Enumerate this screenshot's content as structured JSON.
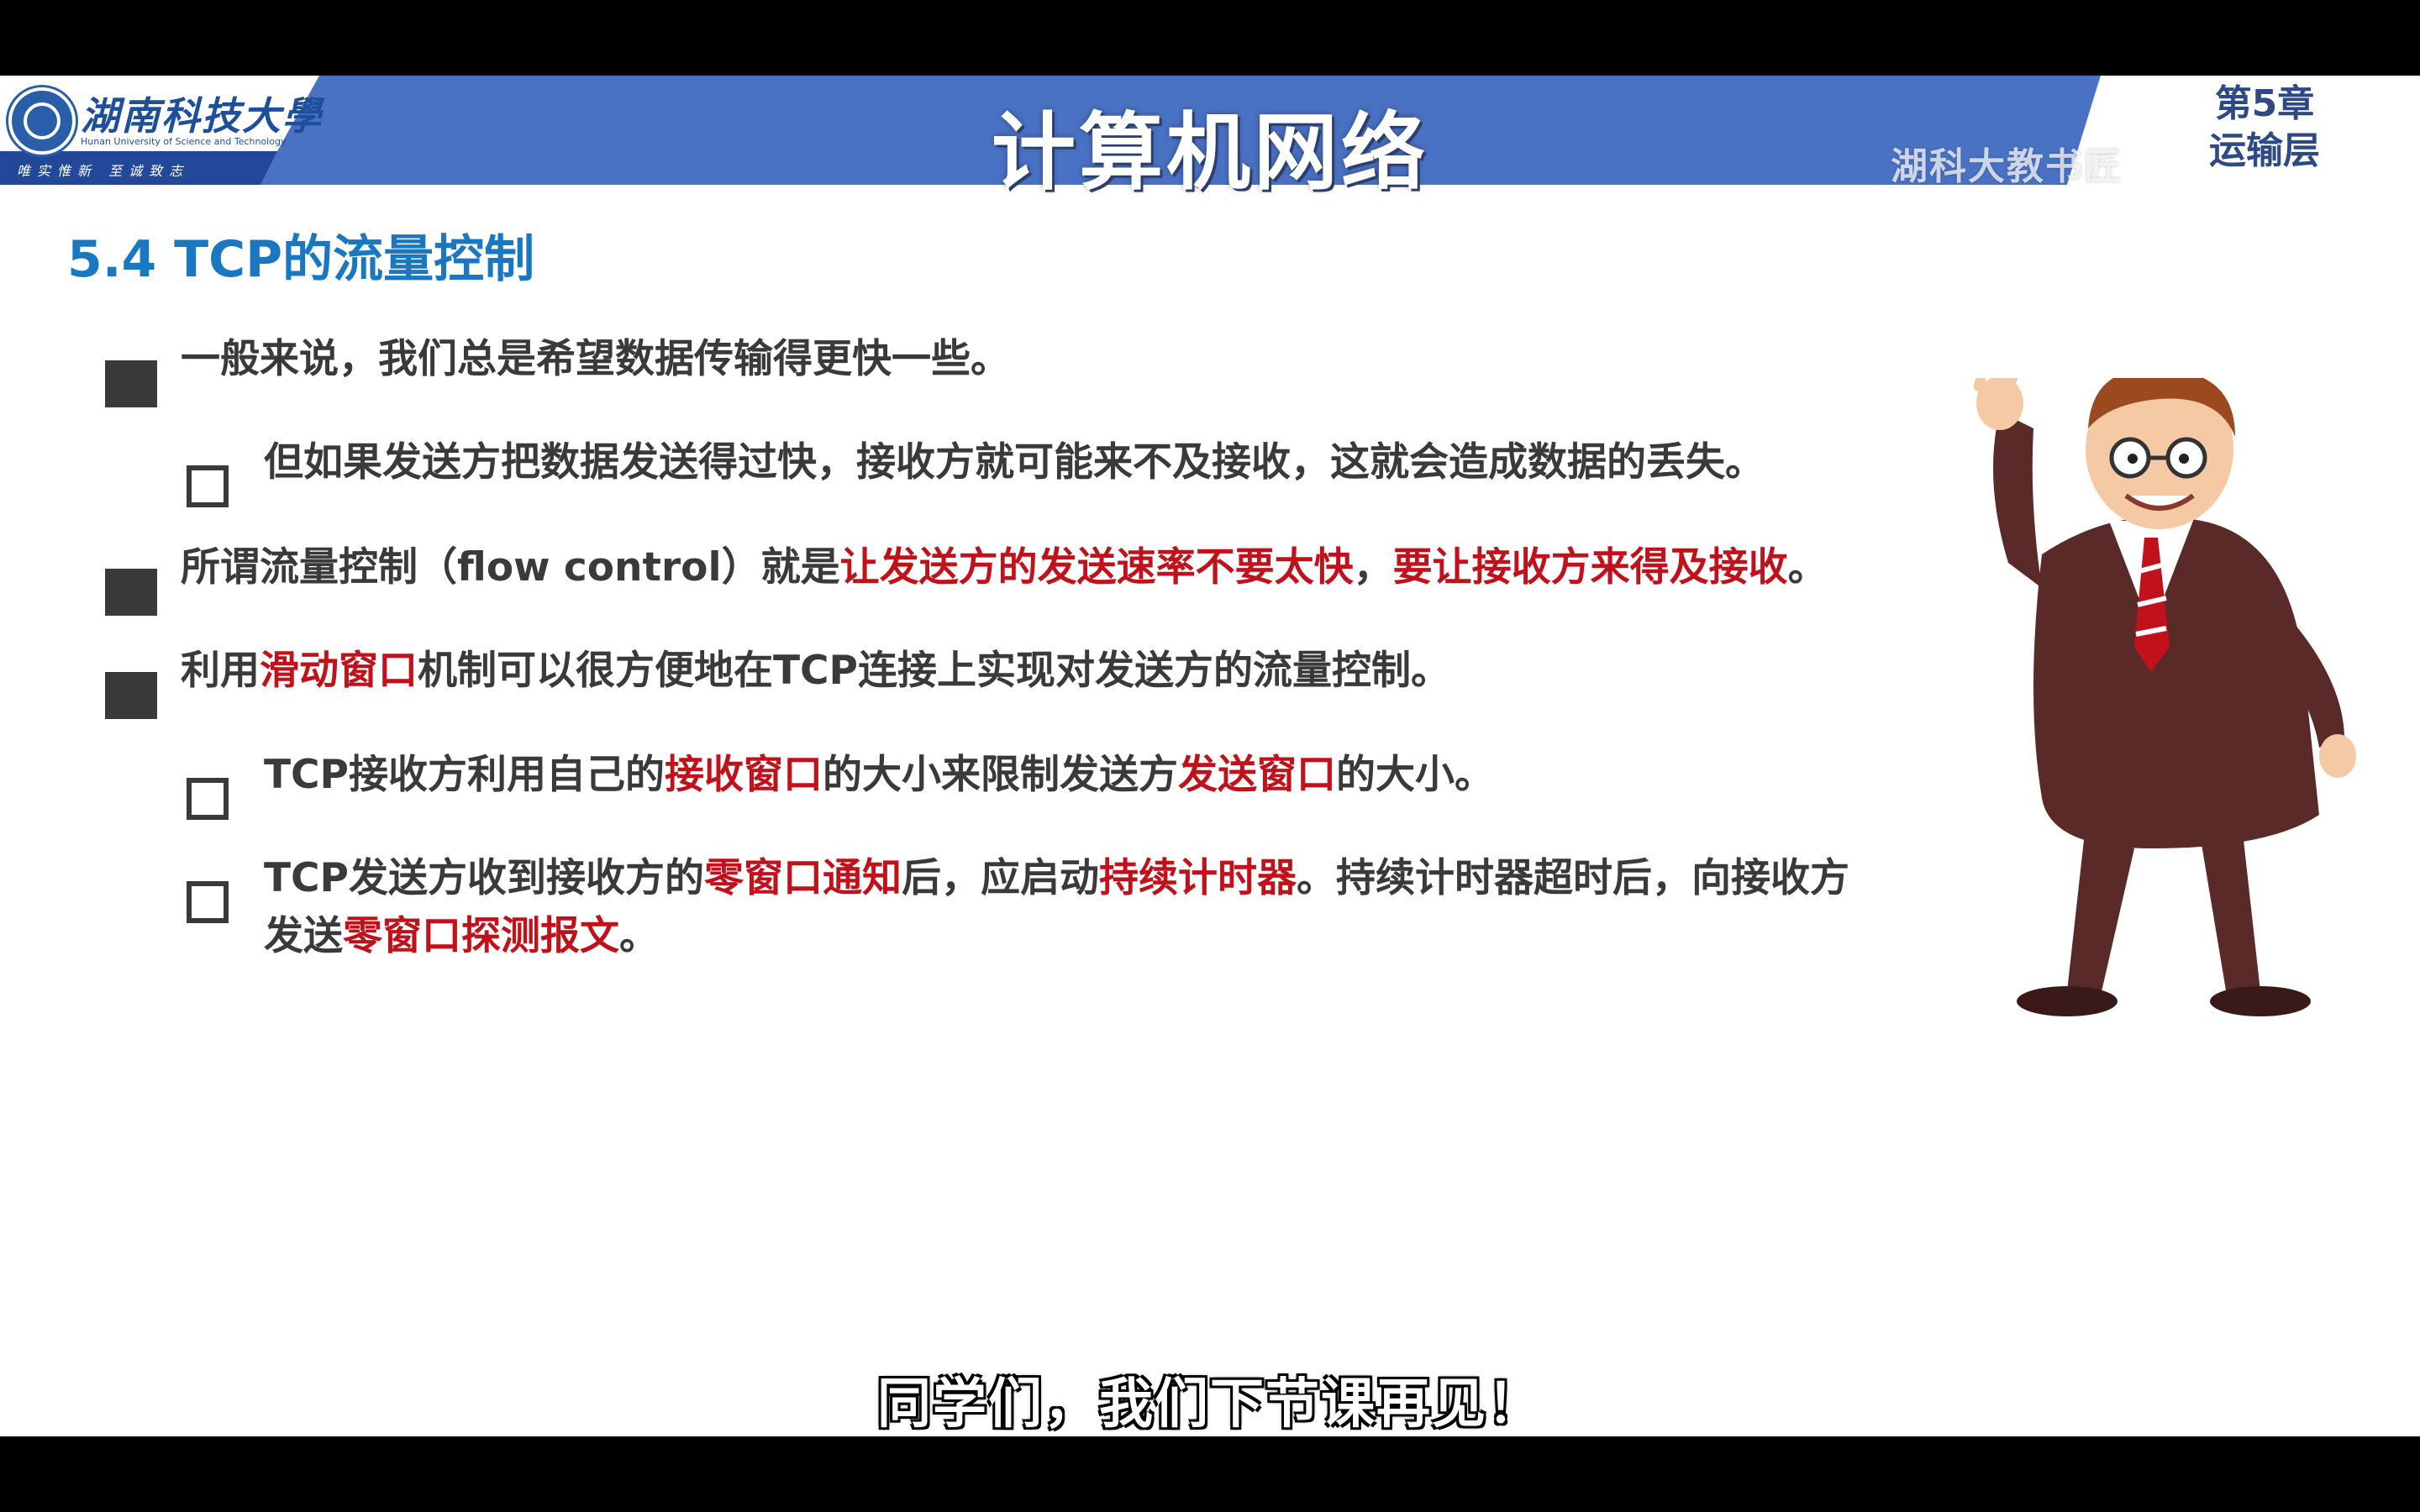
{
  "header": {
    "university_name_cn": "湖南科技大學",
    "university_name_en": "Hunan University of Science and Technology",
    "university_motto": "唯实惟新 至诚致志",
    "course_title": "计算机网络",
    "chapter_label_line1": "第5章",
    "chapter_label_line2": "运输层",
    "watermark": "湖科大教书匠",
    "band_color": "#4a72c4",
    "accent_color": "#1a78c2"
  },
  "slide": {
    "section_heading": "5.4 TCP的流量控制",
    "bullets": [
      {
        "level": 1,
        "parts": [
          {
            "text": "一般来说，我们总是希望数据传输得更快一些。",
            "highlight": false
          }
        ]
      },
      {
        "level": 2,
        "parts": [
          {
            "text": "但如果发送方把数据发送得过快，接收方就可能来不及接收，这就会造成数据的丢失。",
            "highlight": false
          }
        ]
      },
      {
        "level": 1,
        "parts": [
          {
            "text": "所谓流量控制（flow control）就是",
            "highlight": false
          },
          {
            "text": "让发送方的发送速率不要太快",
            "highlight": true
          },
          {
            "text": "，",
            "highlight": false
          },
          {
            "text": "要让接收方来得及接收",
            "highlight": true
          },
          {
            "text": "。",
            "highlight": false
          }
        ]
      },
      {
        "level": 1,
        "parts": [
          {
            "text": "利用",
            "highlight": false
          },
          {
            "text": "滑动窗口",
            "highlight": true
          },
          {
            "text": "机制可以很方便地在TCP连接上实现对发送方的流量控制。",
            "highlight": false
          }
        ]
      },
      {
        "level": 2,
        "parts": [
          {
            "text": "TCP接收方利用自己的",
            "highlight": false
          },
          {
            "text": "接收窗口",
            "highlight": true
          },
          {
            "text": "的大小来限制发送方",
            "highlight": false
          },
          {
            "text": "发送窗口",
            "highlight": true
          },
          {
            "text": "的大小。",
            "highlight": false
          }
        ]
      },
      {
        "level": 2,
        "parts": [
          {
            "text": "TCP发送方收到接收方的",
            "highlight": false
          },
          {
            "text": "零窗口通知",
            "highlight": true
          },
          {
            "text": "后，应启动",
            "highlight": false
          },
          {
            "text": "持续计时器",
            "highlight": true
          },
          {
            "text": "。持续计时器超时后，向接收方",
            "highlight": false
          }
        ],
        "continuation": [
          {
            "text": "发送",
            "highlight": false
          },
          {
            "text": "零窗口探测报文",
            "highlight": true
          },
          {
            "text": "。",
            "highlight": false
          }
        ]
      }
    ],
    "highlight_color": "#c1121c",
    "text_color": "#3a3a3a"
  },
  "illustration": {
    "icon": "waving-cartoon-teacher-icon"
  },
  "video": {
    "subtitle": "同学们，我们下节课再见！"
  }
}
